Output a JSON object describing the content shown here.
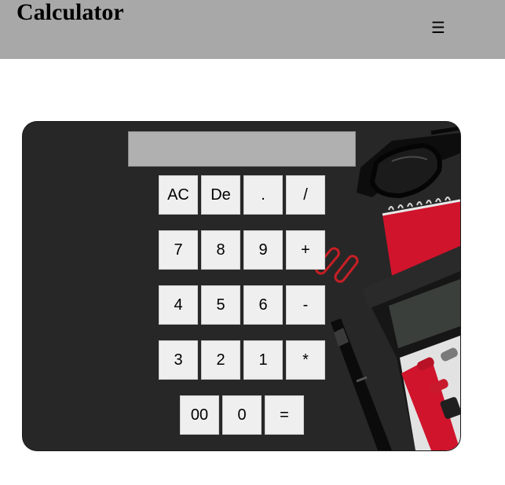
{
  "header": {
    "title": "Calculator",
    "menu_icon": "hamburger-icon",
    "menu_glyph": "☰",
    "background": "#a8a8a8"
  },
  "calculator": {
    "display_value": "",
    "rows": [
      [
        "AC",
        "De",
        ".",
        "/"
      ],
      [
        "7",
        "8",
        "9",
        "+"
      ],
      [
        "4",
        "5",
        "6",
        "-"
      ],
      [
        "3",
        "2",
        "1",
        "*"
      ],
      [
        "00",
        "0",
        "="
      ]
    ]
  },
  "colors": {
    "key_background": "#efefef",
    "display_background": "#b0b0b0",
    "card_background": "#252525",
    "accent_red": "#d0142c"
  }
}
